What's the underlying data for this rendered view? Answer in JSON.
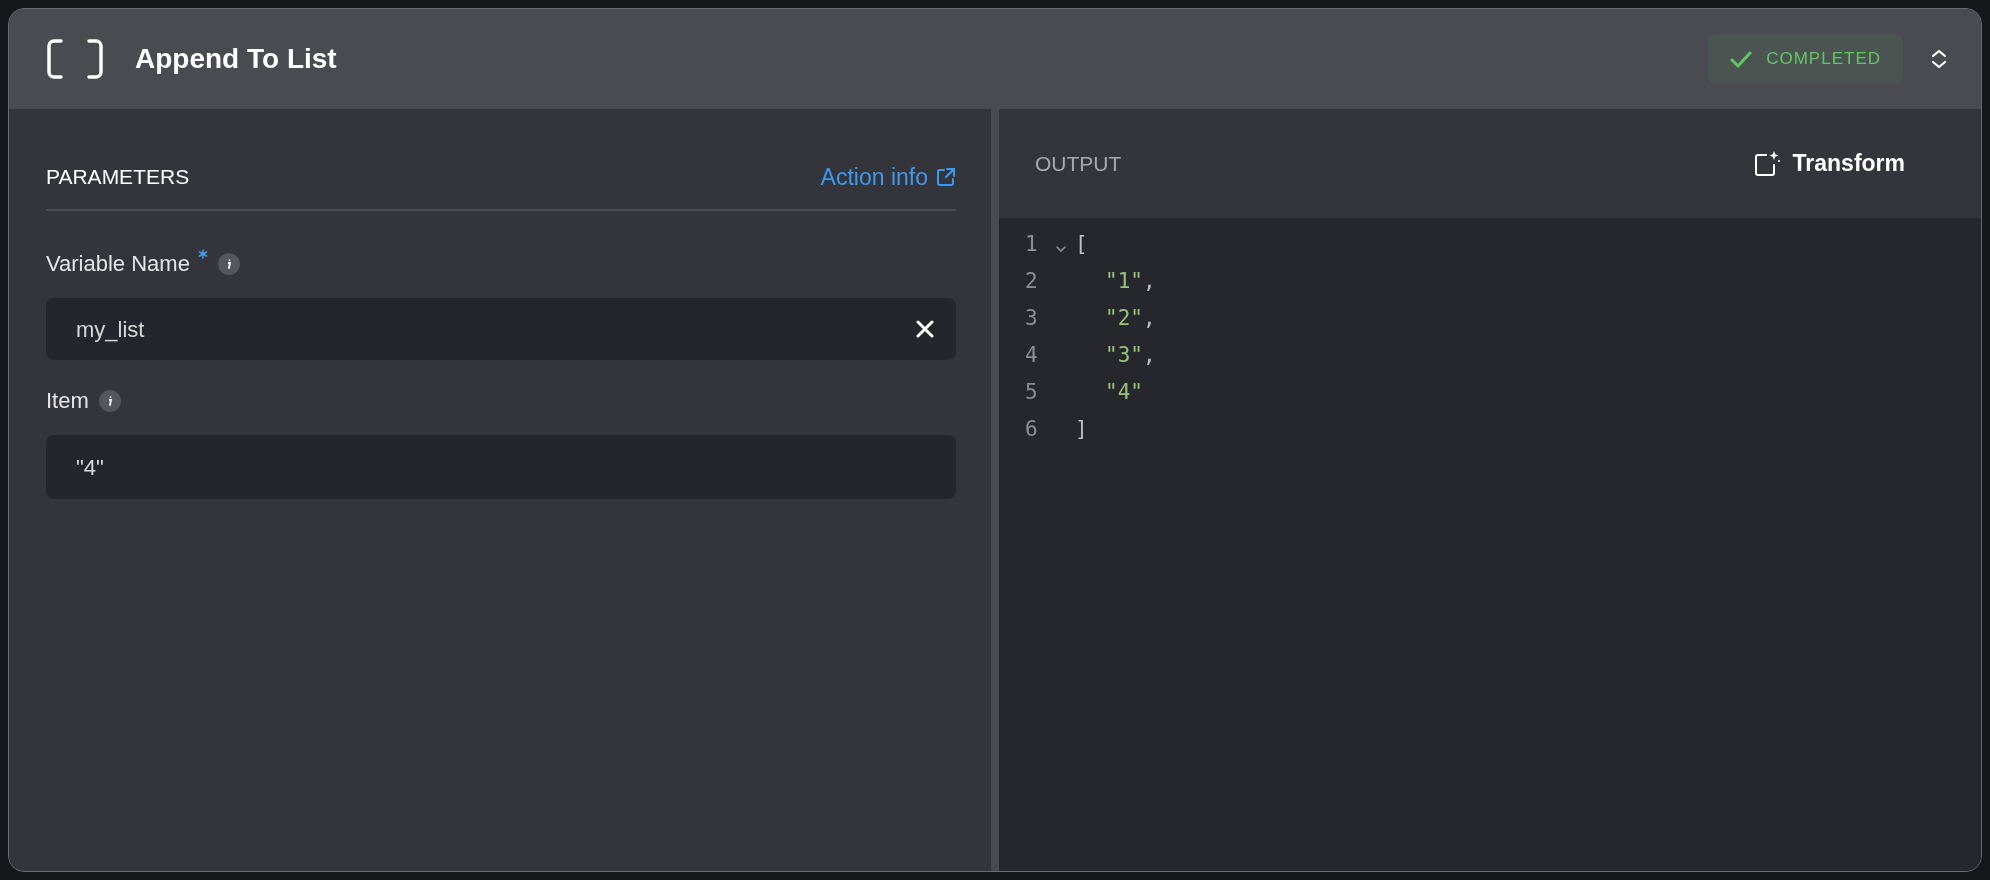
{
  "header": {
    "title": "Append To List",
    "status": {
      "label": "COMPLETED",
      "kind": "success"
    }
  },
  "parameters": {
    "title": "PARAMETERS",
    "link": "Action info",
    "fields": [
      {
        "label": "Variable Name",
        "required": true,
        "value": "my_list",
        "clearable": true
      },
      {
        "label": "Item",
        "required": false,
        "value": "\"4\"",
        "clearable": false
      }
    ]
  },
  "output": {
    "title": "OUTPUT",
    "action": "Transform",
    "lines": [
      {
        "number": "1",
        "kind": "bracket",
        "foldable": true,
        "text": "["
      },
      {
        "number": "2",
        "kind": "item",
        "foldable": false,
        "text": "\"1\"",
        "punct": ","
      },
      {
        "number": "3",
        "kind": "item",
        "foldable": false,
        "text": "\"2\"",
        "punct": ","
      },
      {
        "number": "4",
        "kind": "item",
        "foldable": false,
        "text": "\"3\"",
        "punct": ","
      },
      {
        "number": "5",
        "kind": "item",
        "foldable": false,
        "text": "\"4\""
      },
      {
        "number": "6",
        "kind": "bracket",
        "foldable": false,
        "text": "]"
      }
    ]
  }
}
